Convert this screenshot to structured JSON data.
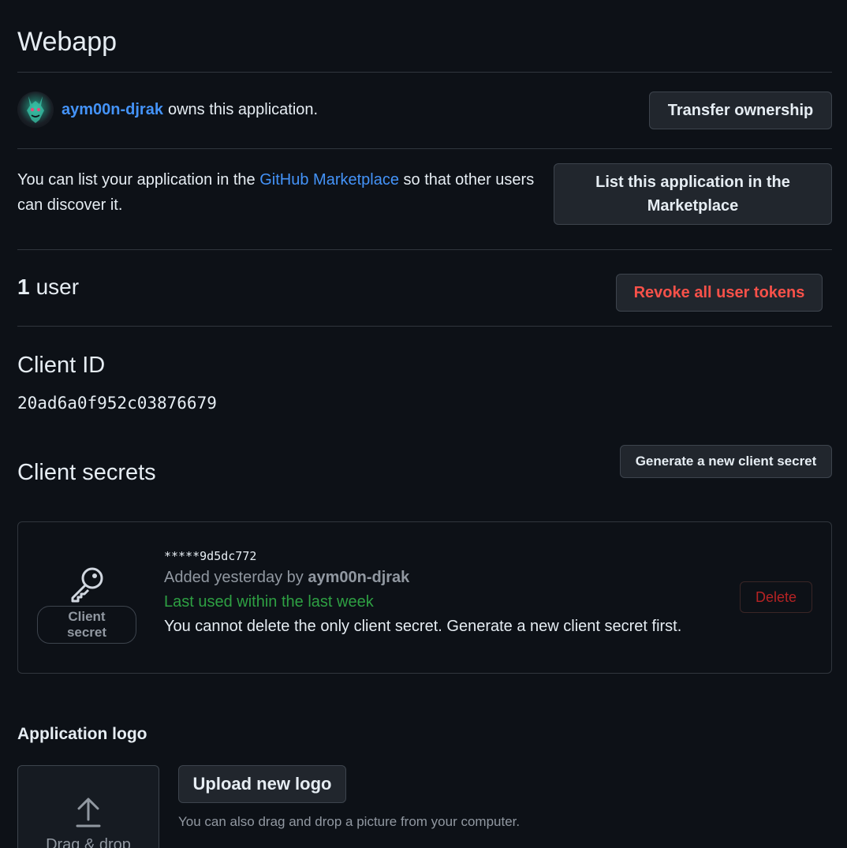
{
  "app": {
    "title": "Webapp"
  },
  "owner": {
    "username": "aym00n-djrak",
    "suffix": "owns this application.",
    "transfer_label": "Transfer ownership"
  },
  "marketplace": {
    "text_before": "You can list your application in the ",
    "link_text": "GitHub Marketplace",
    "text_after": " so that other users can discover it.",
    "button_label": "List this application in the Marketplace"
  },
  "users": {
    "count": "1",
    "label": "user",
    "revoke_label": "Revoke all user tokens"
  },
  "client_id": {
    "title": "Client ID",
    "value": "20ad6a0f952c03876679"
  },
  "client_secrets": {
    "title": "Client secrets",
    "generate_label": "Generate a new client secret",
    "secret": {
      "badge_label": "Client secret",
      "masked_value": "*****9d5dc772",
      "added_text": "Added yesterday by",
      "added_by": "aym00n-djrak",
      "last_used": "Last used within the last week",
      "warning": "You cannot delete the only client secret. Generate a new client secret first.",
      "delete_label": "Delete"
    }
  },
  "logo": {
    "title": "Application logo",
    "dropzone_label": "Drag & drop",
    "upload_label": "Upload new logo",
    "hint": "You can also drag and drop a picture from your computer."
  },
  "colors": {
    "background": "#0d1117",
    "link": "#4493f8",
    "danger": "#f85149",
    "success": "#2ea043",
    "border": "#30363d"
  }
}
